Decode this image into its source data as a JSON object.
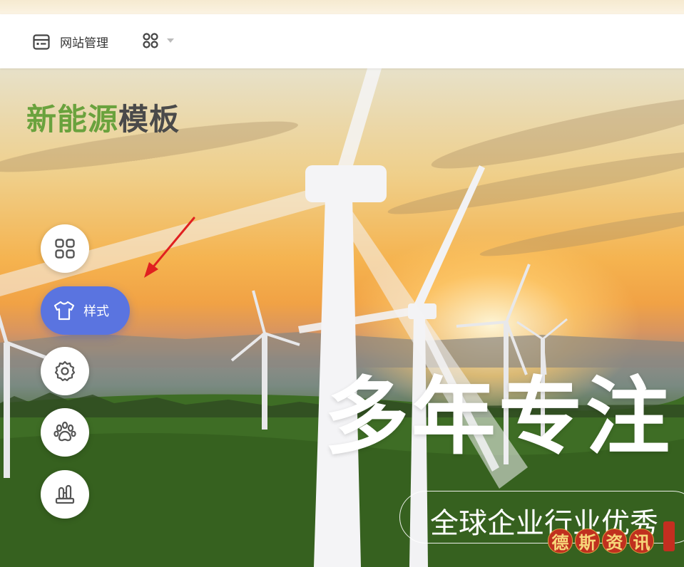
{
  "toolbar": {
    "site_manage_label": "网站管理",
    "apps_icon": "grid-apps-icon",
    "dropdown_icon": "caret-down-icon",
    "site_icon": "browser-window-icon"
  },
  "hero": {
    "logo_green": "新能源",
    "logo_dark": "模板",
    "headline": "多年专注",
    "subline": "全球企业行业优秀"
  },
  "sidebar": {
    "items": [
      {
        "icon": "grid-icon",
        "label": ""
      },
      {
        "icon": "tshirt-icon",
        "label": "样式"
      },
      {
        "icon": "gear-icon",
        "label": ""
      },
      {
        "icon": "paw-icon",
        "label": ""
      },
      {
        "icon": "pencil-holder-icon",
        "label": ""
      }
    ]
  },
  "watermark": {
    "chars": [
      "德",
      "斯",
      "资",
      "讯"
    ]
  },
  "colors": {
    "accent": "#5a74e0",
    "logo_green": "#6aa23d",
    "annotation_arrow": "#e02020"
  }
}
